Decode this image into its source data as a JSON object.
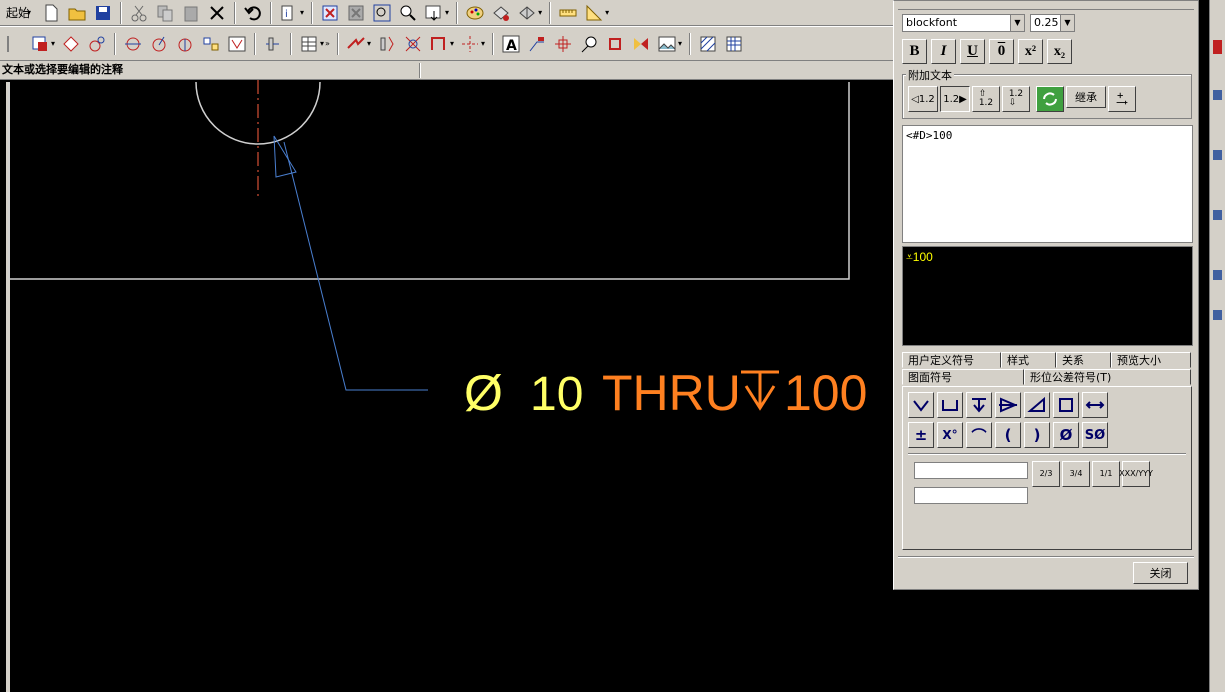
{
  "toolbar": {
    "start_label": "起始"
  },
  "prompt": {
    "text": "文本或选择要编辑的注释"
  },
  "drawing": {
    "hole_symbol": "Ø",
    "hole_size": "10",
    "thru_text": "THRU",
    "depth_value": "100",
    "colors": {
      "geometry": "#d0d0d0",
      "centerline": "#ff6040",
      "leader": "#4a7fd0",
      "dimension_yellow": "#ffff66",
      "dimension_orange": "#ff8020"
    }
  },
  "dialog": {
    "font_select": "blockfont",
    "size_select": "0.25",
    "format_buttons": [
      "B",
      "I",
      "U",
      "0",
      "x²",
      "x₂"
    ],
    "appended_text_group": "附加文本",
    "inherit_button": "继承",
    "edit_text": "<#D>100",
    "preview_text": "100",
    "tabs_row1": [
      "用户定义符号",
      "样式",
      "关系",
      "预览大小"
    ],
    "tabs_row2": [
      "图面符号",
      "形位公差符号(T)"
    ],
    "symbol_row2_labels": [
      "±",
      "X°",
      "⌒",
      "(",
      ")",
      "Ø",
      "SØ"
    ],
    "frac_buttons": [
      "2/3",
      "3/4",
      "1/1",
      "XXX/YYY"
    ],
    "close_button": "关闭"
  }
}
